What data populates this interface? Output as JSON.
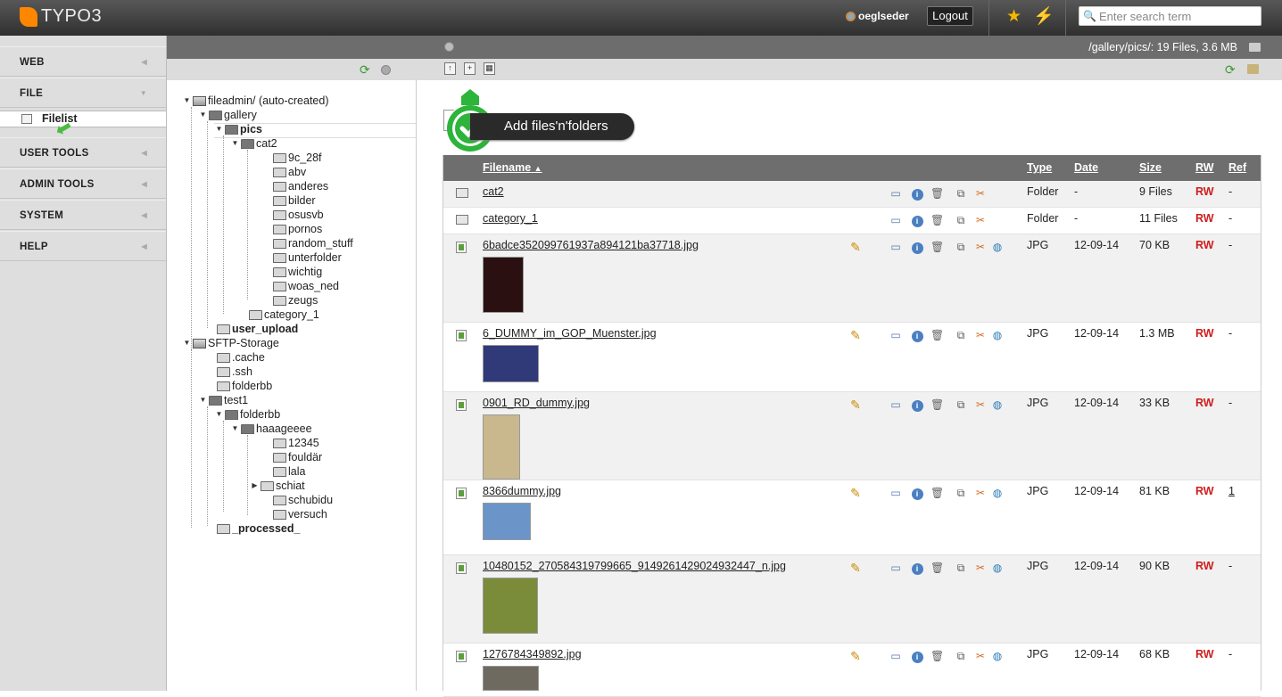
{
  "app": {
    "logo_text": "TYPO3"
  },
  "topbar": {
    "username": "oeglseder",
    "logout_label": "Logout",
    "search_placeholder": "Enter search term"
  },
  "modules": [
    {
      "label": "WEB"
    },
    {
      "label": "FILE"
    },
    {
      "label": "USER TOOLS"
    },
    {
      "label": "ADMIN TOOLS"
    },
    {
      "label": "SYSTEM"
    },
    {
      "label": "HELP"
    }
  ],
  "submodule": {
    "label": "Filelist"
  },
  "docheader": {
    "path": "/gallery/pics/: 19 Files, 3.6 MB"
  },
  "tooltip": {
    "label": "Add files'n'folders"
  },
  "tree": [
    {
      "label": "fileadmin/ (auto-created)",
      "bold": false
    },
    {
      "label": "gallery",
      "bold": false
    },
    {
      "label": "pics",
      "bold": true
    },
    {
      "label": "cat2",
      "bold": false
    },
    {
      "label": "9c_28f",
      "bold": false
    },
    {
      "label": "abv",
      "bold": false
    },
    {
      "label": "anderes",
      "bold": false
    },
    {
      "label": "bilder",
      "bold": false
    },
    {
      "label": "osusvb",
      "bold": false
    },
    {
      "label": "pornos",
      "bold": false
    },
    {
      "label": "random_stuff",
      "bold": false
    },
    {
      "label": "unterfolder",
      "bold": false
    },
    {
      "label": "wichtig",
      "bold": false
    },
    {
      "label": "woas_ned",
      "bold": false
    },
    {
      "label": "zeugs",
      "bold": false
    },
    {
      "label": "category_1",
      "bold": false
    },
    {
      "label": "user_upload",
      "bold": true
    },
    {
      "label": "SFTP-Storage",
      "bold": false
    },
    {
      "label": ".cache",
      "bold": false
    },
    {
      "label": ".ssh",
      "bold": false
    },
    {
      "label": "folderbb",
      "bold": false
    },
    {
      "label": "test1",
      "bold": false
    },
    {
      "label": "folderbb",
      "bold": false
    },
    {
      "label": "haaageeee",
      "bold": false
    },
    {
      "label": "12345",
      "bold": false
    },
    {
      "label": "fouldär",
      "bold": false
    },
    {
      "label": "lala",
      "bold": false
    },
    {
      "label": "schiat",
      "bold": false
    },
    {
      "label": "schubidu",
      "bold": false
    },
    {
      "label": "versuch",
      "bold": false
    },
    {
      "label": "_processed_",
      "bold": true
    }
  ],
  "table": {
    "headers": {
      "filename": "Filename",
      "sort_indicator": "▲",
      "type": "Type",
      "date": "Date",
      "size": "Size",
      "rw": "RW",
      "ref": "Ref"
    },
    "rows": [
      {
        "name": "cat2",
        "type": "Folder",
        "date": "-",
        "size": "9 Files",
        "rw": "RW",
        "ref": "-"
      },
      {
        "name": "category_1",
        "type": "Folder",
        "date": "-",
        "size": "11 Files",
        "rw": "RW",
        "ref": "-"
      },
      {
        "name": "6badce352099761937a894121ba37718.jpg",
        "type": "JPG",
        "date": "12-09-14",
        "size": "70 KB",
        "rw": "RW",
        "ref": "-"
      },
      {
        "name": "6_DUMMY_im_GOP_Muenster.jpg",
        "type": "JPG",
        "date": "12-09-14",
        "size": "1.3 MB",
        "rw": "RW",
        "ref": "-"
      },
      {
        "name": "0901_RD_dummy.jpg",
        "type": "JPG",
        "date": "12-09-14",
        "size": "33 KB",
        "rw": "RW",
        "ref": "-"
      },
      {
        "name": "8366dummy.jpg",
        "type": "JPG",
        "date": "12-09-14",
        "size": "81 KB",
        "rw": "RW",
        "ref": "1"
      },
      {
        "name": "10480152_270584319799665_9149261429024932447_n.jpg",
        "type": "JPG",
        "date": "12-09-14",
        "size": "90 KB",
        "rw": "RW",
        "ref": "-"
      },
      {
        "name": "1276784349892.jpg",
        "type": "JPG",
        "date": "12-09-14",
        "size": "68 KB",
        "rw": "RW",
        "ref": "-"
      }
    ]
  },
  "icons": {
    "pencil": "pencil-icon",
    "info": "info-icon",
    "trash": "trash-icon",
    "copy": "copy-icon",
    "cut": "cut-icon",
    "globe": "globe-icon"
  }
}
